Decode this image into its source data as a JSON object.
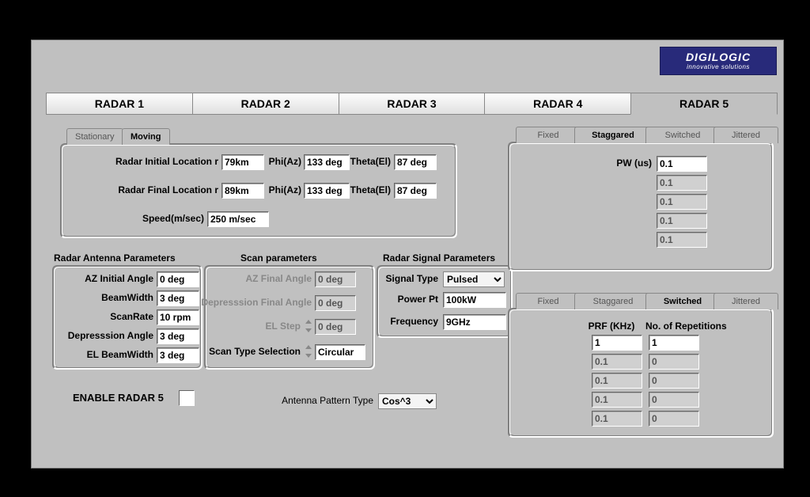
{
  "logo": {
    "word": "DIGILOGIC",
    "tag": "innovative solutions"
  },
  "main_tabs": [
    "RADAR 1",
    "RADAR 2",
    "RADAR 3",
    "RADAR 4",
    "RADAR 5"
  ],
  "loc": {
    "tabs": [
      "Stationary",
      "Moving"
    ],
    "initial_label": "Radar Initial Location",
    "final_label": "Radar Final Location",
    "r": "r",
    "phi": "Phi(Az)",
    "theta": "Theta(El)",
    "speed_label": "Speed(m/sec)",
    "init": {
      "r": "79km",
      "phi": "133 deg",
      "theta": "87 deg"
    },
    "fin": {
      "r": "89km",
      "phi": "133 deg",
      "theta": "87 deg"
    },
    "speed": "250 m/sec"
  },
  "antenna": {
    "heading": "Radar Antenna Parameters",
    "az_init_l": "AZ Initial Angle",
    "az_init": "0 deg",
    "beamw_l": "BeamWidth",
    "beamw": "3 deg",
    "scanrate_l": "ScanRate",
    "scanrate": "10 rpm",
    "depr_l": "Depresssion Angle",
    "depr": "3 deg",
    "elbw_l": "EL BeamWidth",
    "elbw": "3 deg"
  },
  "scan": {
    "heading": "Scan parameters",
    "azfin_l": "AZ Final Angle",
    "azfin": "0 deg",
    "depfin_l": "Depresssion Final Angle",
    "depfin": "0 deg",
    "elstep_l": "EL Step",
    "elstep": "0 deg",
    "sts_l": "Scan Type Selection",
    "sts": "Circular"
  },
  "signal": {
    "heading": "Radar Signal Parameters",
    "type_l": "Signal Type",
    "type": "Pulsed",
    "power_l": "Power Pt",
    "power": "100kW",
    "freq_l": "Frequency",
    "freq": "9GHz"
  },
  "enable": "ENABLE RADAR 5",
  "pattern_l": "Antenna Pattern Type",
  "pattern": "Cos^3",
  "pw": {
    "tabs": [
      "Fixed",
      "Staggared",
      "Switched",
      "Jittered"
    ],
    "heading": "PW (us)",
    "vals": [
      "0.1",
      "0.1",
      "0.1",
      "0.1",
      "0.1"
    ]
  },
  "prf": {
    "tabs": [
      "Fixed",
      "Staggared",
      "Switched",
      "Jittered"
    ],
    "h1": "PRF (KHz)",
    "h2": "No. of Repetitions",
    "col1": [
      "1",
      "0.1",
      "0.1",
      "0.1",
      "0.1"
    ],
    "col2": [
      "1",
      "0",
      "0",
      "0",
      "0"
    ]
  }
}
